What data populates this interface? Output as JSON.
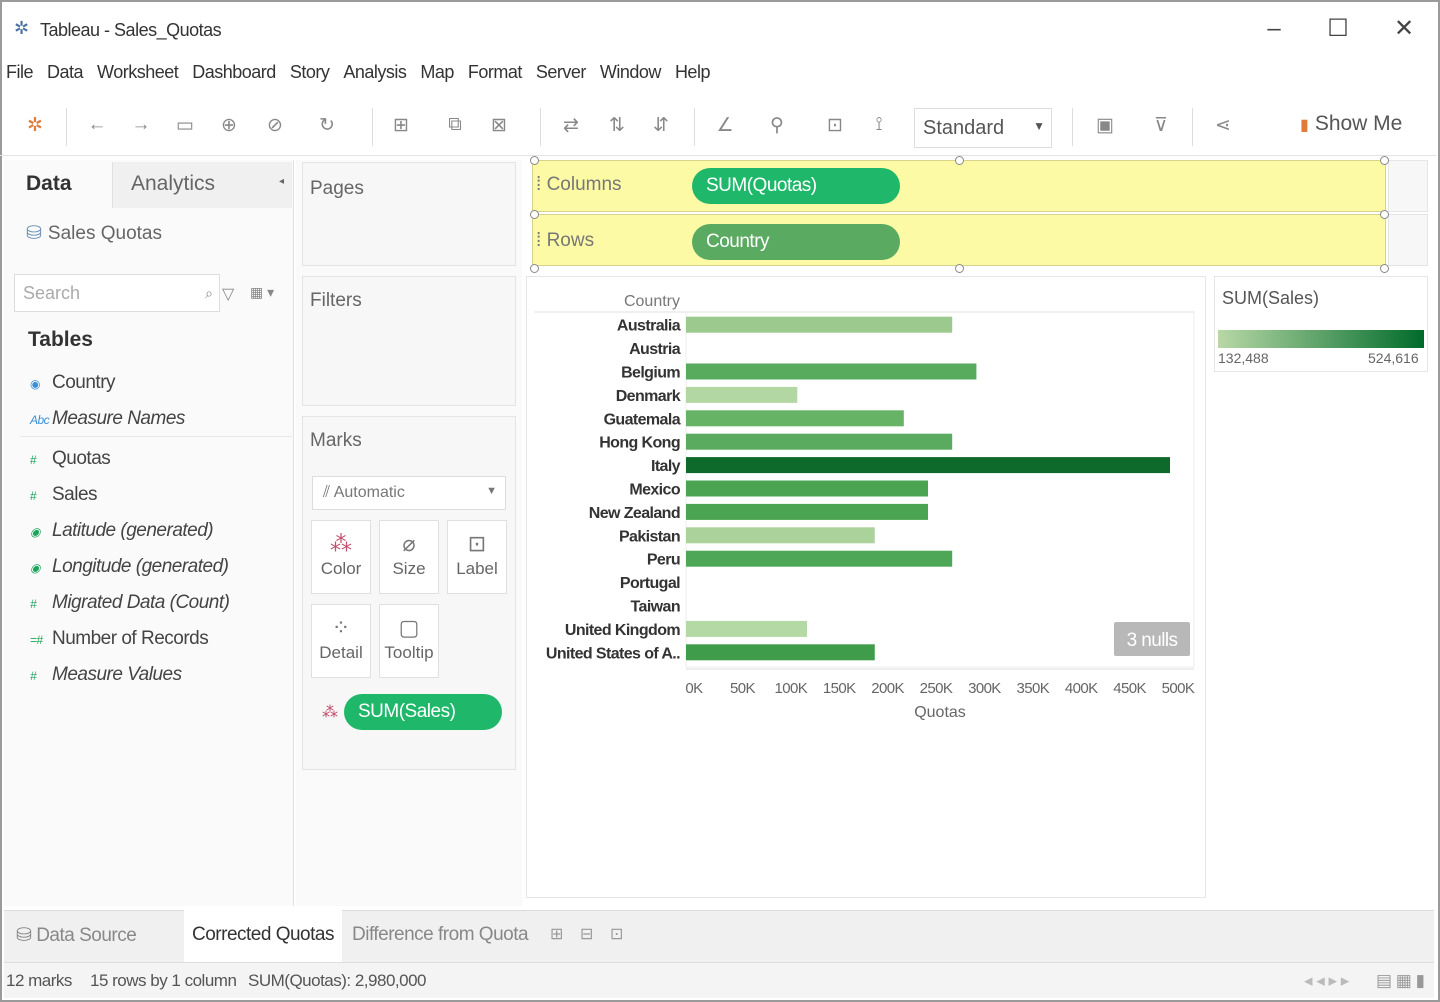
{
  "window": {
    "title": "Tableau - Sales_Quotas",
    "controls": [
      "–",
      "☐",
      "✕"
    ]
  },
  "menu": [
    "File",
    "Data",
    "Worksheet",
    "Dashboard",
    "Story",
    "Analysis",
    "Map",
    "Format",
    "Server",
    "Window",
    "Help"
  ],
  "toolbar": {
    "fit_select": "Standard",
    "show_me": "Show Me"
  },
  "data_pane": {
    "tab_data": "Data",
    "tab_analytics": "Analytics",
    "source": "Sales Quotas",
    "search_placeholder": "Search",
    "tables_header": "Tables",
    "dimensions": [
      {
        "label": "Country",
        "italic": false
      },
      {
        "label": "Measure Names",
        "italic": true
      }
    ],
    "measures": [
      {
        "label": "Quotas",
        "italic": false
      },
      {
        "label": "Sales",
        "italic": false
      },
      {
        "label": "Latitude (generated)",
        "italic": true
      },
      {
        "label": "Longitude (generated)",
        "italic": true
      },
      {
        "label": "Migrated Data (Count)",
        "italic": true
      },
      {
        "label": "Number of Records",
        "italic": false
      },
      {
        "label": "Measure Values",
        "italic": true
      }
    ]
  },
  "cards": {
    "pages": "Pages",
    "filters": "Filters",
    "marks": "Marks",
    "mark_type": "Automatic",
    "buttons": [
      "Color",
      "Size",
      "Label",
      "Detail",
      "Tooltip"
    ],
    "marks_pill": "SUM(Sales)"
  },
  "shelves": {
    "columns_label": "Columns",
    "columns_pill": "SUM(Quotas)",
    "rows_label": "Rows",
    "rows_pill": "Country"
  },
  "legend": {
    "title": "SUM(Sales)",
    "min_label": "132,488",
    "max_label": "524,616",
    "min_color": "#b8d8a6",
    "max_color": "#006b2b"
  },
  "chart_data": {
    "type": "bar",
    "orientation": "horizontal",
    "row_header": "Country",
    "xlabel": "Quotas",
    "xlim": [
      0,
      500000
    ],
    "x_ticks": [
      "0K",
      "50K",
      "100K",
      "150K",
      "200K",
      "250K",
      "300K",
      "350K",
      "400K",
      "450K",
      "500K"
    ],
    "categories": [
      "Australia",
      "Austria",
      "Belgium",
      "Denmark",
      "Guatemala",
      "Hong Kong",
      "Italy",
      "Mexico",
      "New Zealand",
      "Pakistan",
      "Peru",
      "Portugal",
      "Taiwan",
      "United Kingdom",
      "United States of A.."
    ],
    "values": [
      275000,
      null,
      300000,
      115000,
      225000,
      275000,
      500000,
      250000,
      250000,
      195000,
      275000,
      null,
      null,
      125000,
      195000
    ],
    "colors": [
      "#9bc98e",
      null,
      "#58aa5c",
      "#b3d7a3",
      "#66b366",
      "#5aaa5f",
      "#0e6a2b",
      "#4aa451",
      "#4aa451",
      "#acd29c",
      "#4ea756",
      null,
      null,
      "#b5d9a5",
      "#3f9c4a"
    ],
    "nulls_indicator": "3 nulls"
  },
  "sheets": {
    "data_source": "Data Source",
    "tabs": [
      "Corrected Quotas",
      "Difference from Quota"
    ],
    "active": 0
  },
  "status": {
    "marks": "12 marks",
    "dims": "15 rows by 1 column",
    "sum": "SUM(Quotas): 2,980,000"
  }
}
